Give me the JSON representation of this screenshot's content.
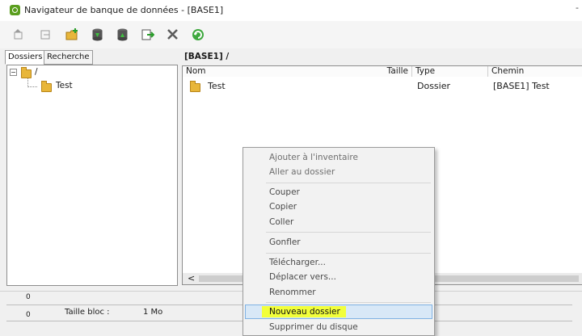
{
  "window": {
    "title": "Navigateur de banque de données - [BASE1]",
    "control": "-"
  },
  "tabs": {
    "dossiers": "Dossiers",
    "recherche": "Recherche"
  },
  "tree": {
    "root": "/",
    "child": "Test"
  },
  "list": {
    "title": "[BASE1] /",
    "columns": {
      "nom": "Nom",
      "taille": "Taille",
      "type": "Type",
      "chemin": "Chemin"
    },
    "rows": [
      {
        "nom": "Test",
        "taille": "",
        "type": "Dossier",
        "chemin": "[BASE1] Test"
      }
    ],
    "scroll_arrow": "<"
  },
  "status": {
    "top_value": "0",
    "bottom_value": "0",
    "block_label": "Taille bloc :",
    "block_value": "1 Mo"
  },
  "context_menu": {
    "items": [
      "Ajouter à l'inventaire",
      "Aller au dossier",
      "Couper",
      "Copier",
      "Coller",
      "Gonfler",
      "Télécharger...",
      "Déplacer vers...",
      "Renommer",
      "Nouveau dossier",
      "Supprimer du disque"
    ],
    "highlighted": "Nouveau dossier",
    "highlight_marker_color": "#f2ff3a"
  },
  "icons": [
    "app-icon",
    "back-icon",
    "forward-icon",
    "new-folder-icon",
    "import-icon",
    "export-icon",
    "move-icon",
    "delete-icon",
    "refresh-icon",
    "folder-icon"
  ]
}
